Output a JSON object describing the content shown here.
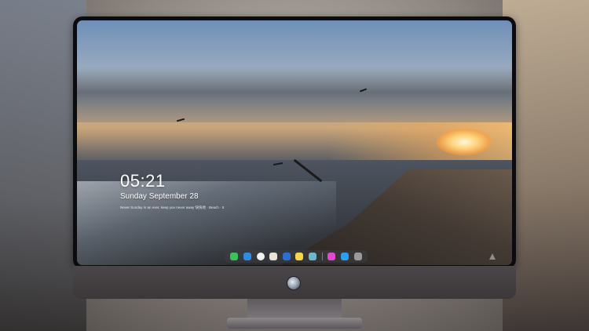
{
  "lockscreen": {
    "time": "05:21",
    "date": "Sunday September  28",
    "subline": "Never Sunday in an ever, keep you never away 快快地 · Beach · 5"
  },
  "dock": {
    "items": [
      {
        "name": "messages-icon",
        "color": "#39c15a"
      },
      {
        "name": "finder-icon",
        "color": "#2f8ae0"
      },
      {
        "name": "safari-icon",
        "color": "#f2f2f2"
      },
      {
        "name": "photos-icon",
        "color": "#e9e4d6"
      },
      {
        "name": "video-icon",
        "color": "#2b6fd1"
      },
      {
        "name": "notes-icon",
        "color": "#f5d54b"
      },
      {
        "name": "preview-icon",
        "color": "#6fb7c8"
      },
      {
        "name": "music-icon",
        "color": "#e04ad1"
      },
      {
        "name": "app-store-icon",
        "color": "#2f9df4"
      },
      {
        "name": "camera-icon",
        "color": "#9a9a9a"
      }
    ]
  }
}
